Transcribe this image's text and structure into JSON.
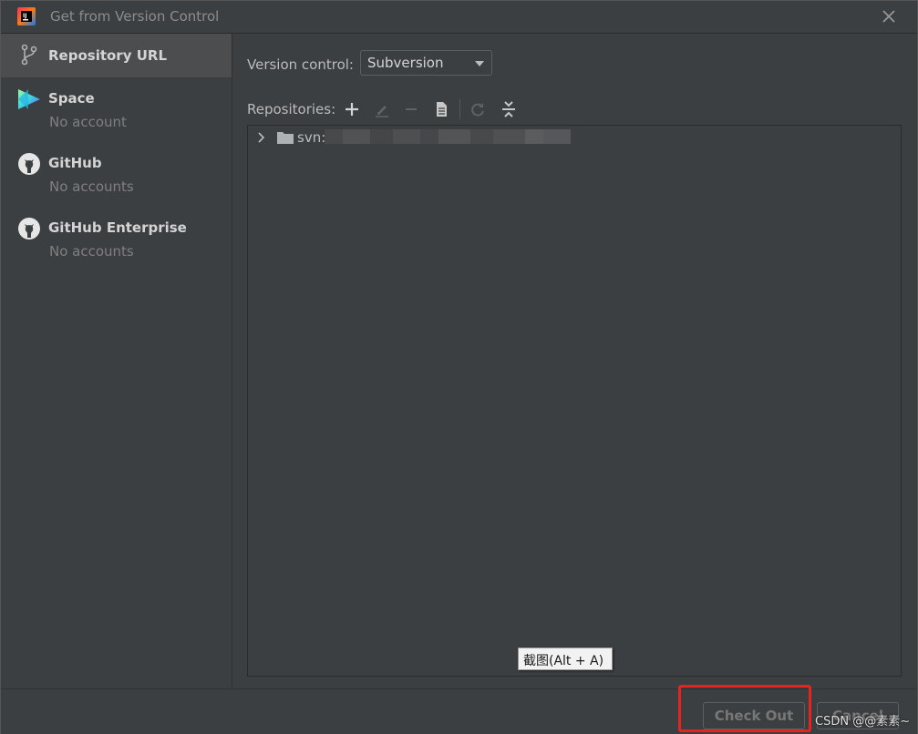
{
  "window": {
    "title": "Get from Version Control"
  },
  "sidebar": {
    "items": [
      {
        "label": "Repository URL",
        "sub": ""
      },
      {
        "label": "Space",
        "sub": "No account"
      },
      {
        "label": "GitHub",
        "sub": "No accounts"
      },
      {
        "label": "GitHub Enterprise",
        "sub": "No accounts"
      }
    ]
  },
  "main": {
    "version_control_label": "Version control:",
    "version_control_value": "Subversion",
    "repositories_label": "Repositories:",
    "toolbar": [
      "plus-icon",
      "edit-icon",
      "minus-icon",
      "browse-icon",
      "refresh-icon",
      "collapse-all-icon"
    ],
    "tree": [
      {
        "text": "svn:/"
      }
    ]
  },
  "tooltip": {
    "text": "截图(Alt + A)"
  },
  "footer": {
    "checkout_label": "Check Out",
    "cancel_label": "Cancel"
  },
  "watermark": "CSDN @@素素~",
  "colors": {
    "background": "#3c3f41",
    "selected": "#4b4d4f",
    "highlight": "#e8231f"
  }
}
